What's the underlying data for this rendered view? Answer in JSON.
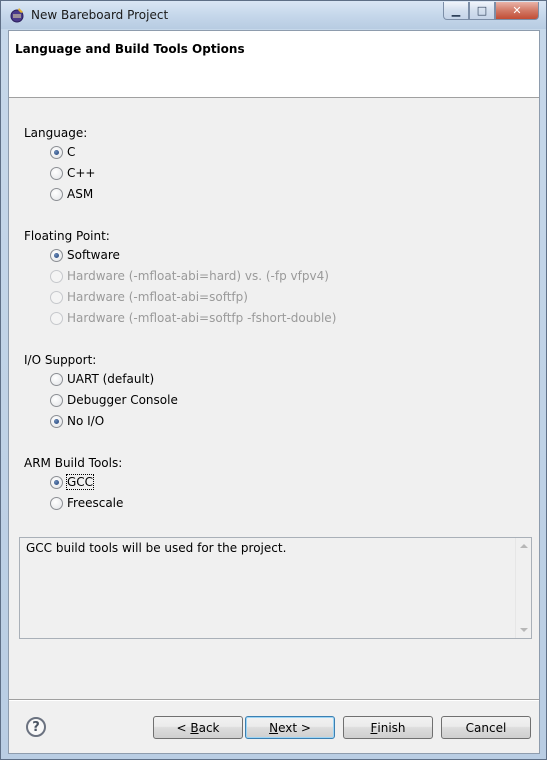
{
  "window": {
    "title": "New Bareboard Project"
  },
  "header": {
    "title": "Language and Build Tools Options"
  },
  "language": {
    "label": "Language:",
    "options": [
      {
        "label": "C",
        "checked": true,
        "enabled": true
      },
      {
        "label": "C++",
        "checked": false,
        "enabled": true
      },
      {
        "label": "ASM",
        "checked": false,
        "enabled": true
      }
    ]
  },
  "floating_point": {
    "label": "Floating Point:",
    "options": [
      {
        "label": "Software",
        "checked": true,
        "enabled": true
      },
      {
        "label": "Hardware (-mfloat-abi=hard) vs. (-fp vfpv4)",
        "checked": false,
        "enabled": false
      },
      {
        "label": "Hardware (-mfloat-abi=softfp)",
        "checked": false,
        "enabled": false
      },
      {
        "label": "Hardware (-mfloat-abi=softfp -fshort-double)",
        "checked": false,
        "enabled": false
      }
    ]
  },
  "io_support": {
    "label": "I/O Support:",
    "options": [
      {
        "label": "UART (default)",
        "checked": false,
        "enabled": true
      },
      {
        "label": "Debugger Console",
        "checked": false,
        "enabled": true
      },
      {
        "label": "No I/O",
        "checked": true,
        "enabled": true
      }
    ]
  },
  "build_tools": {
    "label": "ARM Build Tools:",
    "options": [
      {
        "label": "GCC",
        "checked": true,
        "enabled": true
      },
      {
        "label": "Freescale",
        "checked": false,
        "enabled": true
      }
    ]
  },
  "description": {
    "text": "GCC build tools will be used for the project."
  },
  "buttons": {
    "back": {
      "prefix": "< ",
      "mnemonic": "B",
      "rest": "ack"
    },
    "next": {
      "mnemonic": "N",
      "rest": "ext >"
    },
    "finish": {
      "mnemonic": "F",
      "rest": "inish"
    },
    "cancel": "Cancel",
    "help": "?"
  },
  "icons": {
    "app": "eclipse-wizard-icon",
    "minimize": "minimize-icon",
    "maximize": "maximize-icon",
    "close": "close-icon",
    "help": "help-icon"
  }
}
